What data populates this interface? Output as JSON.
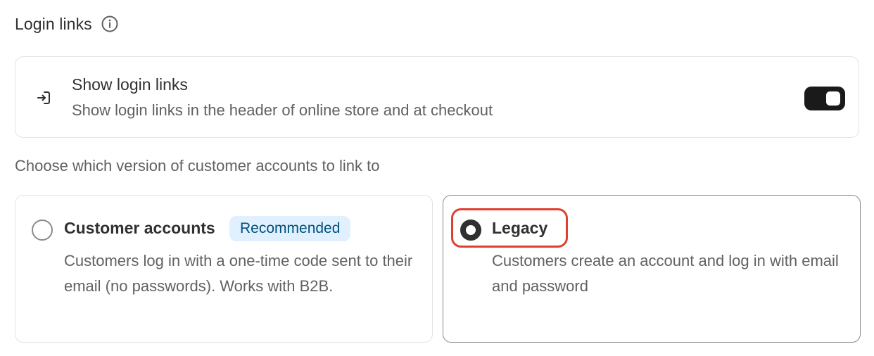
{
  "section": {
    "title": "Login links",
    "info_icon": "info-circle-icon"
  },
  "toggle_card": {
    "icon": "login-arrow-icon",
    "title": "Show login links",
    "description": "Show login links in the header of online store and at checkout",
    "enabled": true
  },
  "choose_prompt": "Choose which version of customer accounts to link to",
  "options": [
    {
      "title": "Customer accounts",
      "badge": "Recommended",
      "description": "Customers log in with a one-time code sent to their email (no passwords). Works with B2B.",
      "selected": false
    },
    {
      "title": "Legacy",
      "description": "Customers create an account and log in with email and password",
      "selected": true
    }
  ],
  "colors": {
    "text_primary": "#303030",
    "text_secondary": "#616161",
    "badge_bg": "#e0f0ff",
    "badge_text": "#00527c",
    "toggle_on": "#1a1a1a",
    "highlight": "#e0402e"
  }
}
